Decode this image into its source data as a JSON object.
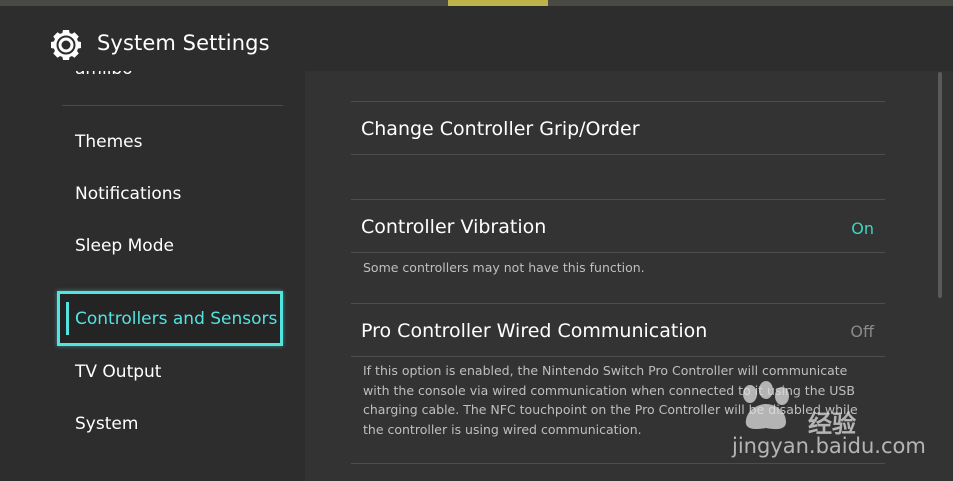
{
  "header": {
    "title": "System Settings",
    "icon": "gear-icon"
  },
  "sidebar": {
    "partial_item": "amiibo",
    "items": [
      {
        "label": "Themes"
      },
      {
        "label": "Notifications"
      },
      {
        "label": "Sleep Mode"
      },
      {
        "label": "Controllers and Sensors",
        "selected": true
      },
      {
        "label": "TV Output"
      },
      {
        "label": "System"
      }
    ]
  },
  "main": {
    "grip_order": {
      "label": "Change Controller Grip/Order"
    },
    "vibration": {
      "label": "Controller Vibration",
      "value": "On",
      "description": "Some controllers may not have this function."
    },
    "pro_wired": {
      "label": "Pro Controller Wired Communication",
      "value": "Off",
      "description": "If this option is enabled, the Nintendo Switch Pro Controller will communicate with the console via wired communication when connected to it using the USB charging cable. The NFC touchpoint on the Pro Controller will be disabled while the controller is using wired communication."
    }
  },
  "watermark": {
    "brand_cn": "经验",
    "url": "jingyan.baidu.com"
  },
  "colors": {
    "accent": "#53e4e0",
    "value_on": "#3ad8c0",
    "value_off": "#8a8a8a",
    "background": "#2d2d2d"
  }
}
